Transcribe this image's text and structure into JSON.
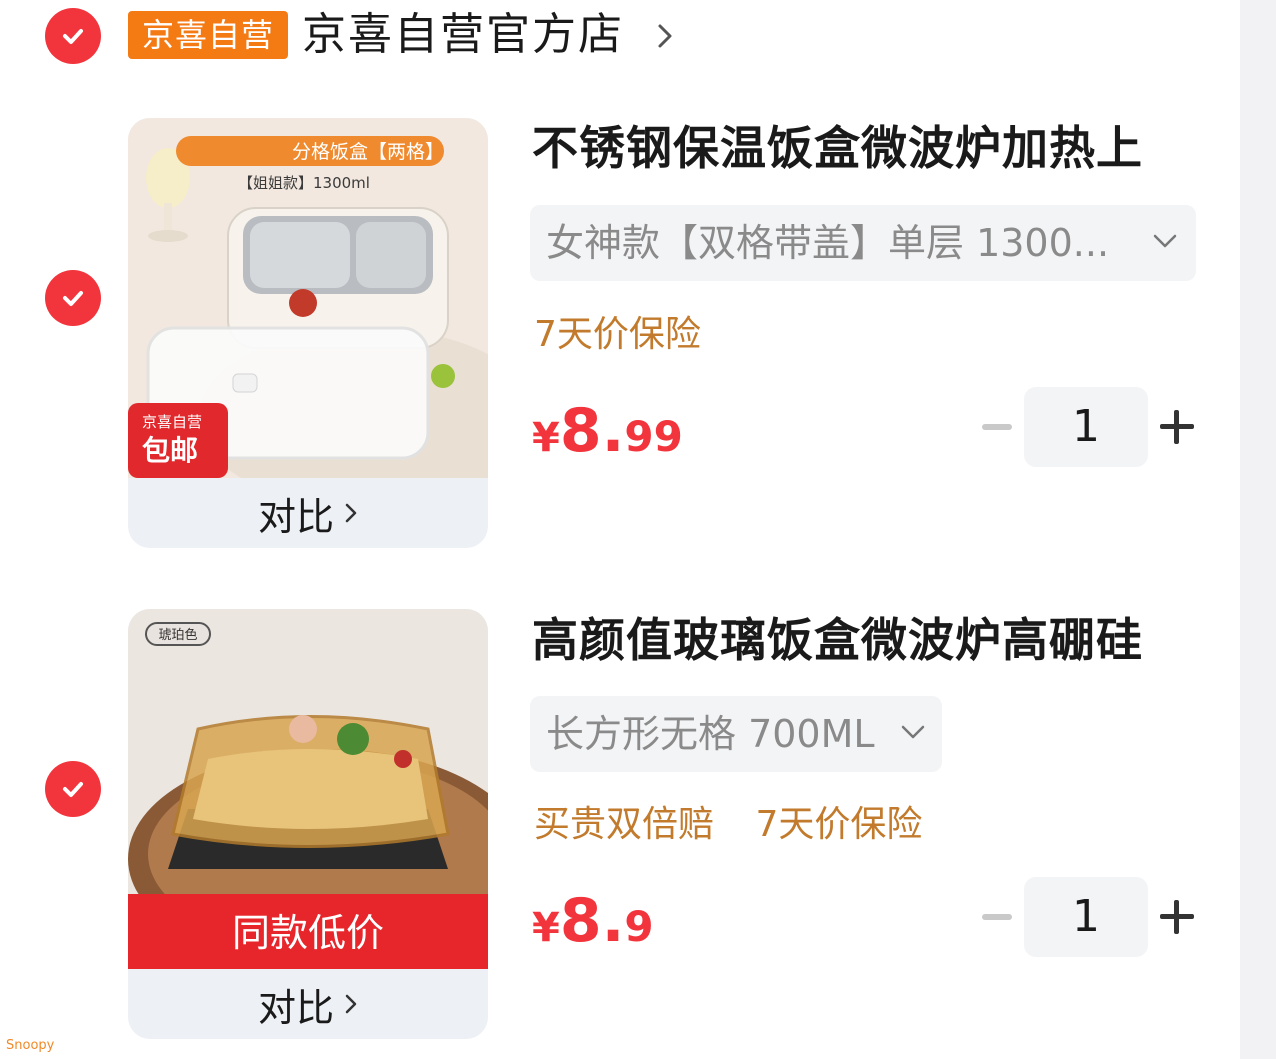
{
  "store": {
    "badge": "京喜自营",
    "name": "京喜自营官方店"
  },
  "products": [
    {
      "title": "不锈钢保温饭盒微波炉加热上",
      "variant": "女神款【双格带盖】单层 1300...",
      "tags": [
        "7天价保险"
      ],
      "price_currency": "¥",
      "price_int": "8.",
      "price_dec": "99",
      "quantity": "1",
      "compare_label": "对比",
      "image_banner": "分格饭盒【两格】",
      "image_subtext": "【姐姐款】1300ml",
      "image_badge_line1": "京喜自营",
      "image_badge_line2": "包邮"
    },
    {
      "title": "高颜值玻璃饭盒微波炉高硼硅",
      "variant": "长方形无格 700ML",
      "tags": [
        "买贵双倍赔",
        "7天价保险"
      ],
      "price_currency": "¥",
      "price_int": "8.",
      "price_dec": "9",
      "quantity": "1",
      "compare_label": "对比",
      "image_tag": "琥珀色",
      "image_banner": "同款低价"
    }
  ],
  "colors": {
    "accent_red": "#f2353d",
    "store_orange": "#f47a14",
    "tag_brown": "#c27a2c"
  },
  "watermark": "Snoopy"
}
